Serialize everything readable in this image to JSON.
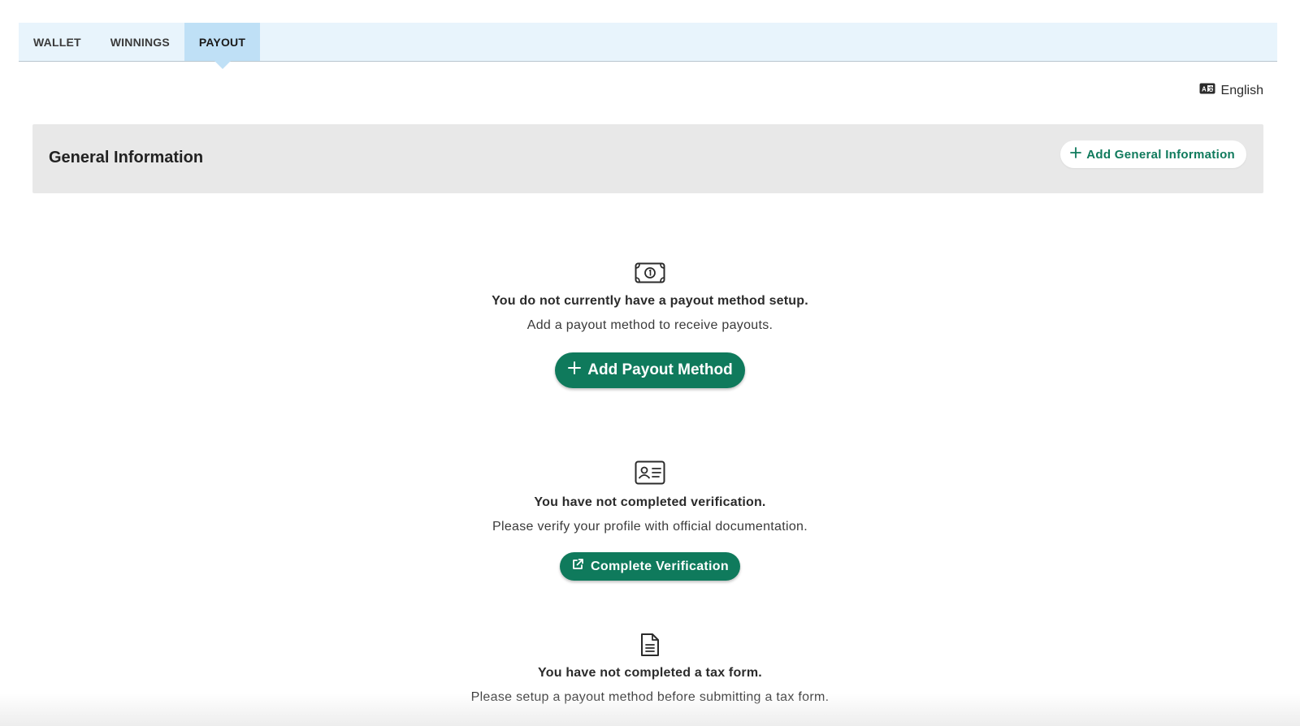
{
  "tabs": [
    {
      "label": "WALLET",
      "active": false
    },
    {
      "label": "WINNINGS",
      "active": false
    },
    {
      "label": "PAYOUT",
      "active": true
    }
  ],
  "language": {
    "label": "English",
    "icon": "language-card-icon"
  },
  "general_info": {
    "title": "General Information",
    "add_button_label": "Add General Information",
    "add_button_icon": "plus-icon"
  },
  "payout_method": {
    "icon": "money-bill-icon",
    "title": "You do not currently have a payout method setup.",
    "subtitle": "Add a payout method to receive payouts.",
    "button_label": "Add Payout Method",
    "button_icon": "plus-icon"
  },
  "verification": {
    "icon": "id-card-icon",
    "title": "You have not completed verification.",
    "subtitle": "Please verify your profile with official documentation.",
    "button_label": "Complete Verification",
    "button_icon": "external-link-icon"
  },
  "tax_form": {
    "icon": "document-icon",
    "title": "You have not completed a tax form.",
    "subtitle": "Please setup a payout method before submitting a tax form."
  },
  "colors": {
    "accent": "#0f7a5c",
    "tabbar_bg": "#e8f4fc",
    "active_tab_bg": "#bfe0f6",
    "panel_bg": "#e8e8e8"
  }
}
